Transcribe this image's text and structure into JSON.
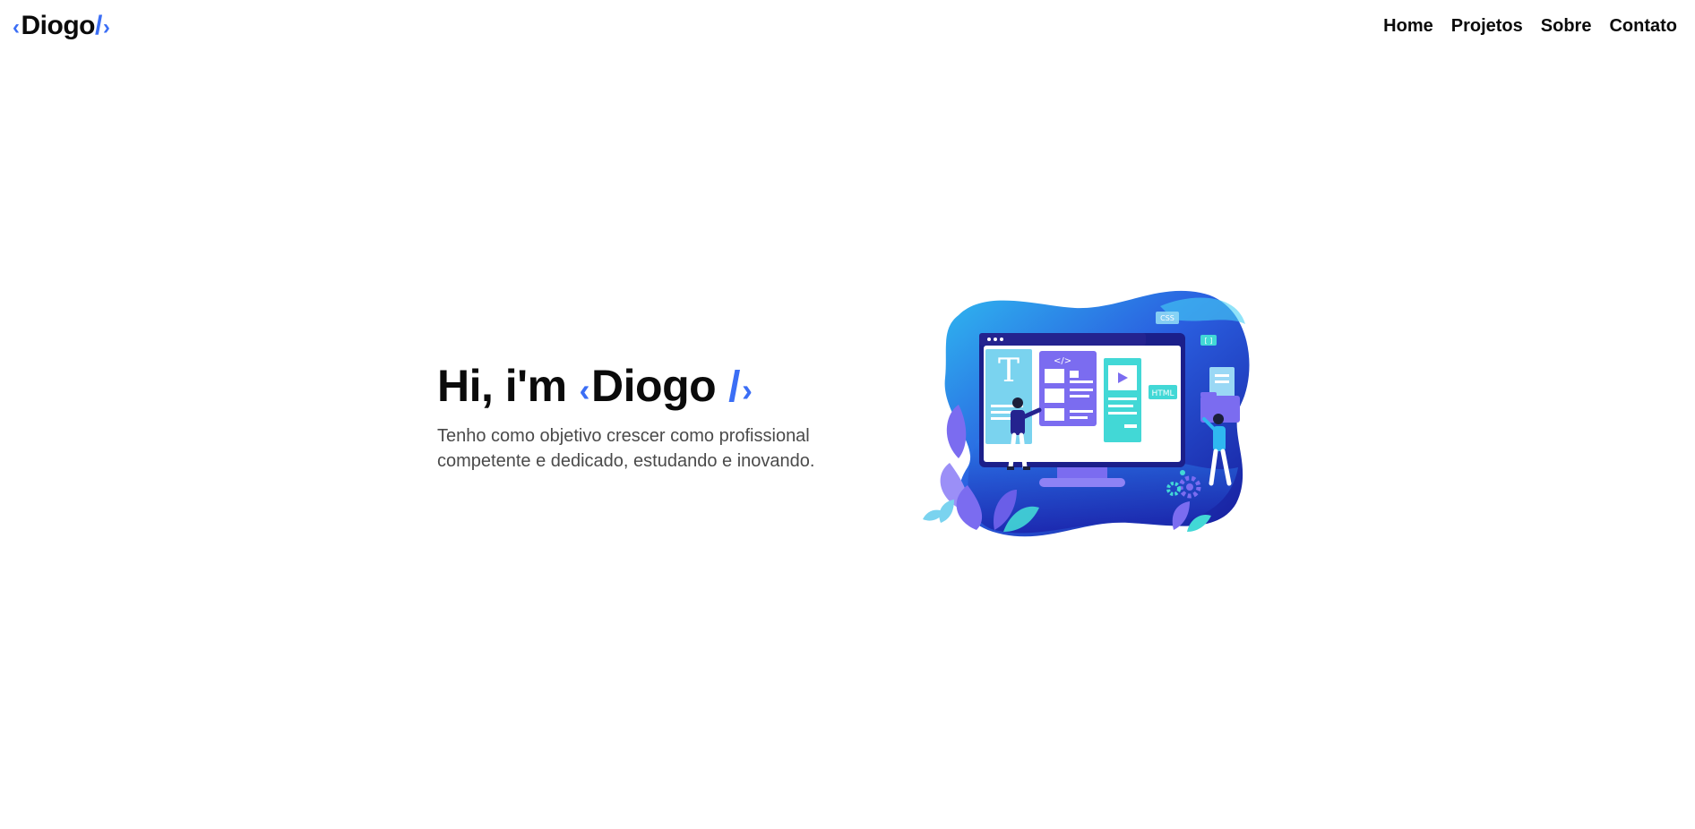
{
  "header": {
    "logo": {
      "open": "‹",
      "name": "Diogo",
      "slash": "/",
      "close": "›"
    },
    "nav": [
      {
        "label": "Home"
      },
      {
        "label": "Projetos"
      },
      {
        "label": "Sobre"
      },
      {
        "label": "Contato"
      }
    ]
  },
  "hero": {
    "title_prefix": "Hi, i'm",
    "title_open": "‹",
    "title_name": "Diogo",
    "title_slash": "/",
    "title_close": "›",
    "description": "Tenho como objetivo crescer como profissional competente e dedicado, estudando e inovando.",
    "illustration": {
      "icon": "web-developer-illustration",
      "labels": {
        "css": "CSS",
        "html": "HTML",
        "code": "</>",
        "t": "T",
        "brackets": "[ ]"
      }
    }
  },
  "colors": {
    "accent": "#3b6ef5",
    "text": "#0b0b0b",
    "muted": "#4a4a4a",
    "blob_dark": "#1a1fa8",
    "blob_light": "#2fb8f0",
    "screen_purple": "#7b6cf0",
    "screen_teal": "#42d8d6"
  }
}
